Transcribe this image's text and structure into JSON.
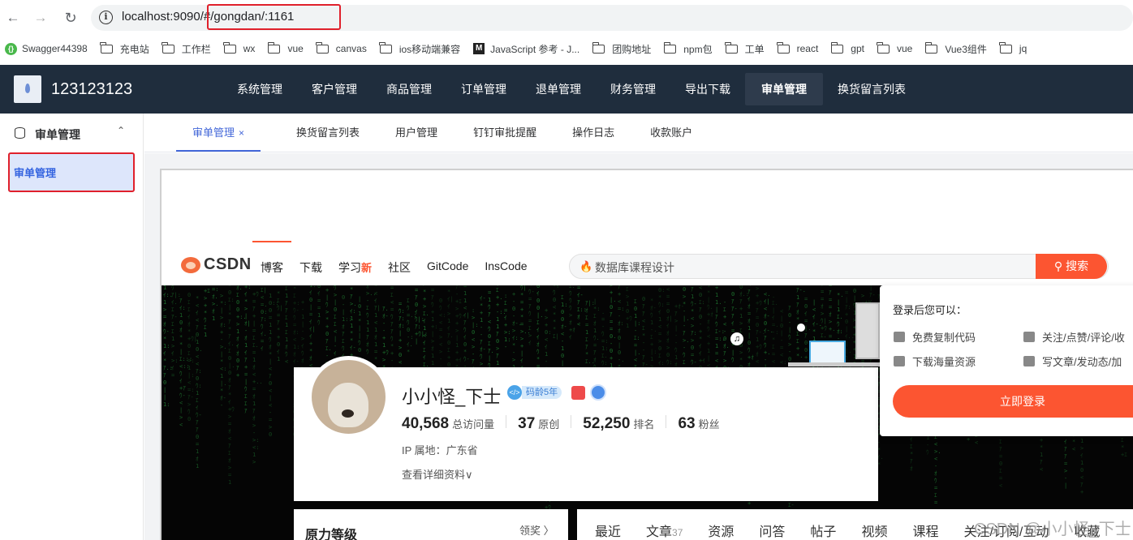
{
  "browser": {
    "url_prefix": "localhost:9090/#",
    "url_hash": "/gongdan/:1161",
    "bookmarks": [
      {
        "label": "Swagger44398",
        "icon": "swagger-icon"
      },
      {
        "label": "充电站",
        "icon": "folder-icon"
      },
      {
        "label": "工作栏",
        "icon": "folder-icon"
      },
      {
        "label": "wx",
        "icon": "folder-icon"
      },
      {
        "label": "vue",
        "icon": "folder-icon"
      },
      {
        "label": "canvas",
        "icon": "folder-icon"
      },
      {
        "label": "ios移动端兼容",
        "icon": "folder-icon"
      },
      {
        "label": "JavaScript 参考 - J...",
        "icon": "mdn-icon"
      },
      {
        "label": "团购地址",
        "icon": "folder-icon"
      },
      {
        "label": "npm包",
        "icon": "folder-icon"
      },
      {
        "label": "工单",
        "icon": "folder-icon"
      },
      {
        "label": "react",
        "icon": "folder-icon"
      },
      {
        "label": "gpt",
        "icon": "folder-icon"
      },
      {
        "label": "vue",
        "icon": "folder-icon"
      },
      {
        "label": "Vue3组件",
        "icon": "folder-icon"
      },
      {
        "label": "jq",
        "icon": "folder-icon"
      }
    ]
  },
  "app": {
    "title": "123123123",
    "topnav": [
      "系统管理",
      "客户管理",
      "商品管理",
      "订单管理",
      "退单管理",
      "财务管理",
      "导出下载",
      "审单管理",
      "换货留言列表"
    ],
    "topnav_active": "审单管理"
  },
  "sidebar": {
    "title": "审单管理",
    "items": [
      {
        "label": "审单管理"
      }
    ]
  },
  "tabs": [
    {
      "label": "审单管理",
      "active": true,
      "close": "×"
    },
    {
      "label": "换货留言列表"
    },
    {
      "label": "用户管理"
    },
    {
      "label": "钉钉审批提醒"
    },
    {
      "label": "操作日志"
    },
    {
      "label": "收款账户"
    }
  ],
  "csdn": {
    "logo": "CSDN",
    "nav": [
      "博客",
      "下载",
      "学习",
      "社区",
      "GitCode",
      "InsCode"
    ],
    "nav_new": "新",
    "search_placeholder": "数据库课程设计",
    "search_button": "搜索",
    "profile": {
      "name": "小小怪_下士",
      "age_badge": "码龄5年",
      "stats": [
        {
          "value": "40,568",
          "label": "总访问量"
        },
        {
          "value": "37",
          "label": "原创"
        },
        {
          "value": "52,250",
          "label": "排名"
        },
        {
          "value": "63",
          "label": "粉丝"
        }
      ],
      "ip": "IP 属地：广东省",
      "more": "查看详细资料∨"
    },
    "level": {
      "title": "原力等级",
      "link": "领奖 〉"
    },
    "content_tabs": [
      {
        "label": "最近"
      },
      {
        "label": "文章",
        "count": "37"
      },
      {
        "label": "资源"
      },
      {
        "label": "问答"
      },
      {
        "label": "帖子"
      },
      {
        "label": "视频"
      },
      {
        "label": "课程"
      },
      {
        "label": "关注/订阅/互动"
      },
      {
        "label": "收藏"
      }
    ],
    "login": {
      "title": "登录后您可以：",
      "items": [
        "免费复制代码",
        "关注/点赞/评论/收",
        "下载海量资源",
        "写文章/发动态/加"
      ],
      "button": "立即登录"
    },
    "watermark": "CSDN @小小怪_下士"
  },
  "colors": {
    "accent": "#4468d9",
    "header": "#1f2d3d",
    "csdn": "#fc5531",
    "highlight": "#e0202b"
  }
}
